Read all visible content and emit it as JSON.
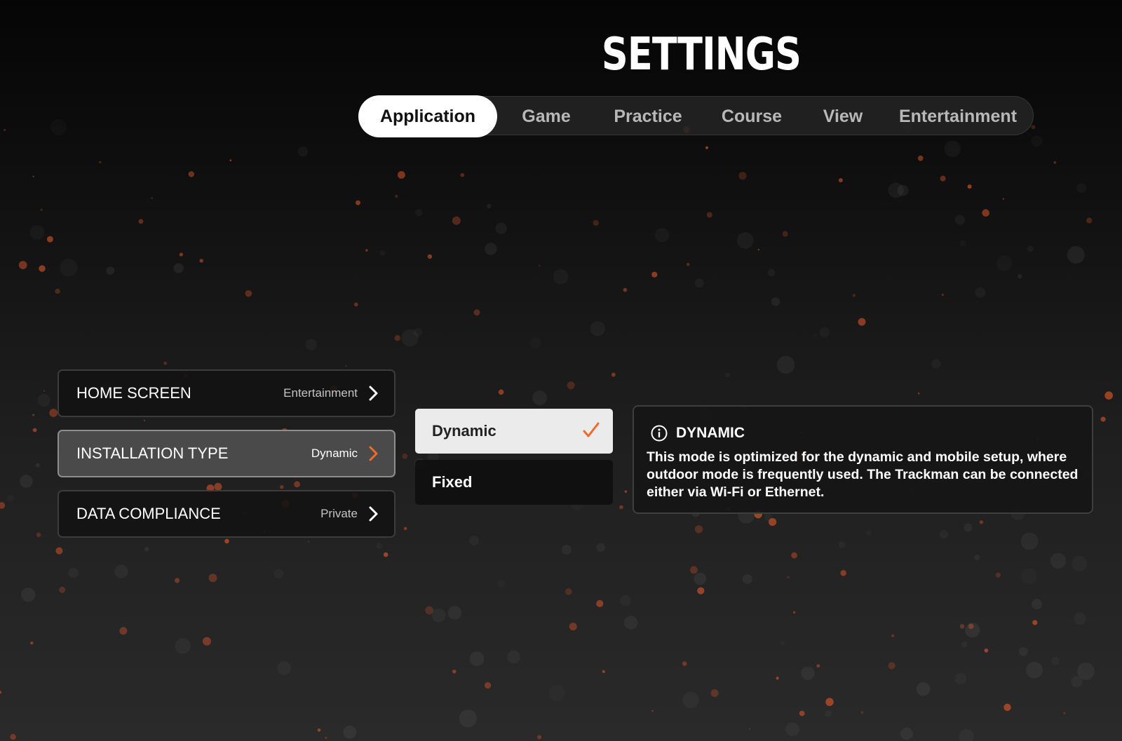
{
  "page_title": "SETTINGS",
  "tabs": [
    {
      "label": "Application",
      "active": true
    },
    {
      "label": "Game",
      "active": false
    },
    {
      "label": "Practice",
      "active": false
    },
    {
      "label": "Course",
      "active": false
    },
    {
      "label": "View",
      "active": false
    },
    {
      "label": "Entertainment",
      "active": false
    }
  ],
  "settings": [
    {
      "label": "HOME SCREEN",
      "value": "Entertainment",
      "active": false
    },
    {
      "label": "INSTALLATION TYPE",
      "value": "Dynamic",
      "active": true
    },
    {
      "label": "DATA COMPLIANCE",
      "value": "Private",
      "active": false
    }
  ],
  "options": [
    {
      "label": "Dynamic",
      "selected": true
    },
    {
      "label": "Fixed",
      "selected": false
    }
  ],
  "info": {
    "icon": "info-icon",
    "title": "DYNAMIC",
    "text": "This mode is optimized for the dynamic and mobile setup, where outdoor mode is frequently used. The Trackman can be connected either via Wi-Fi or Ethernet."
  },
  "colors": {
    "accent": "#f06a2a",
    "background": "#111111",
    "tab_active_bg": "#ffffff",
    "option_selected_bg": "#ebebeb"
  }
}
